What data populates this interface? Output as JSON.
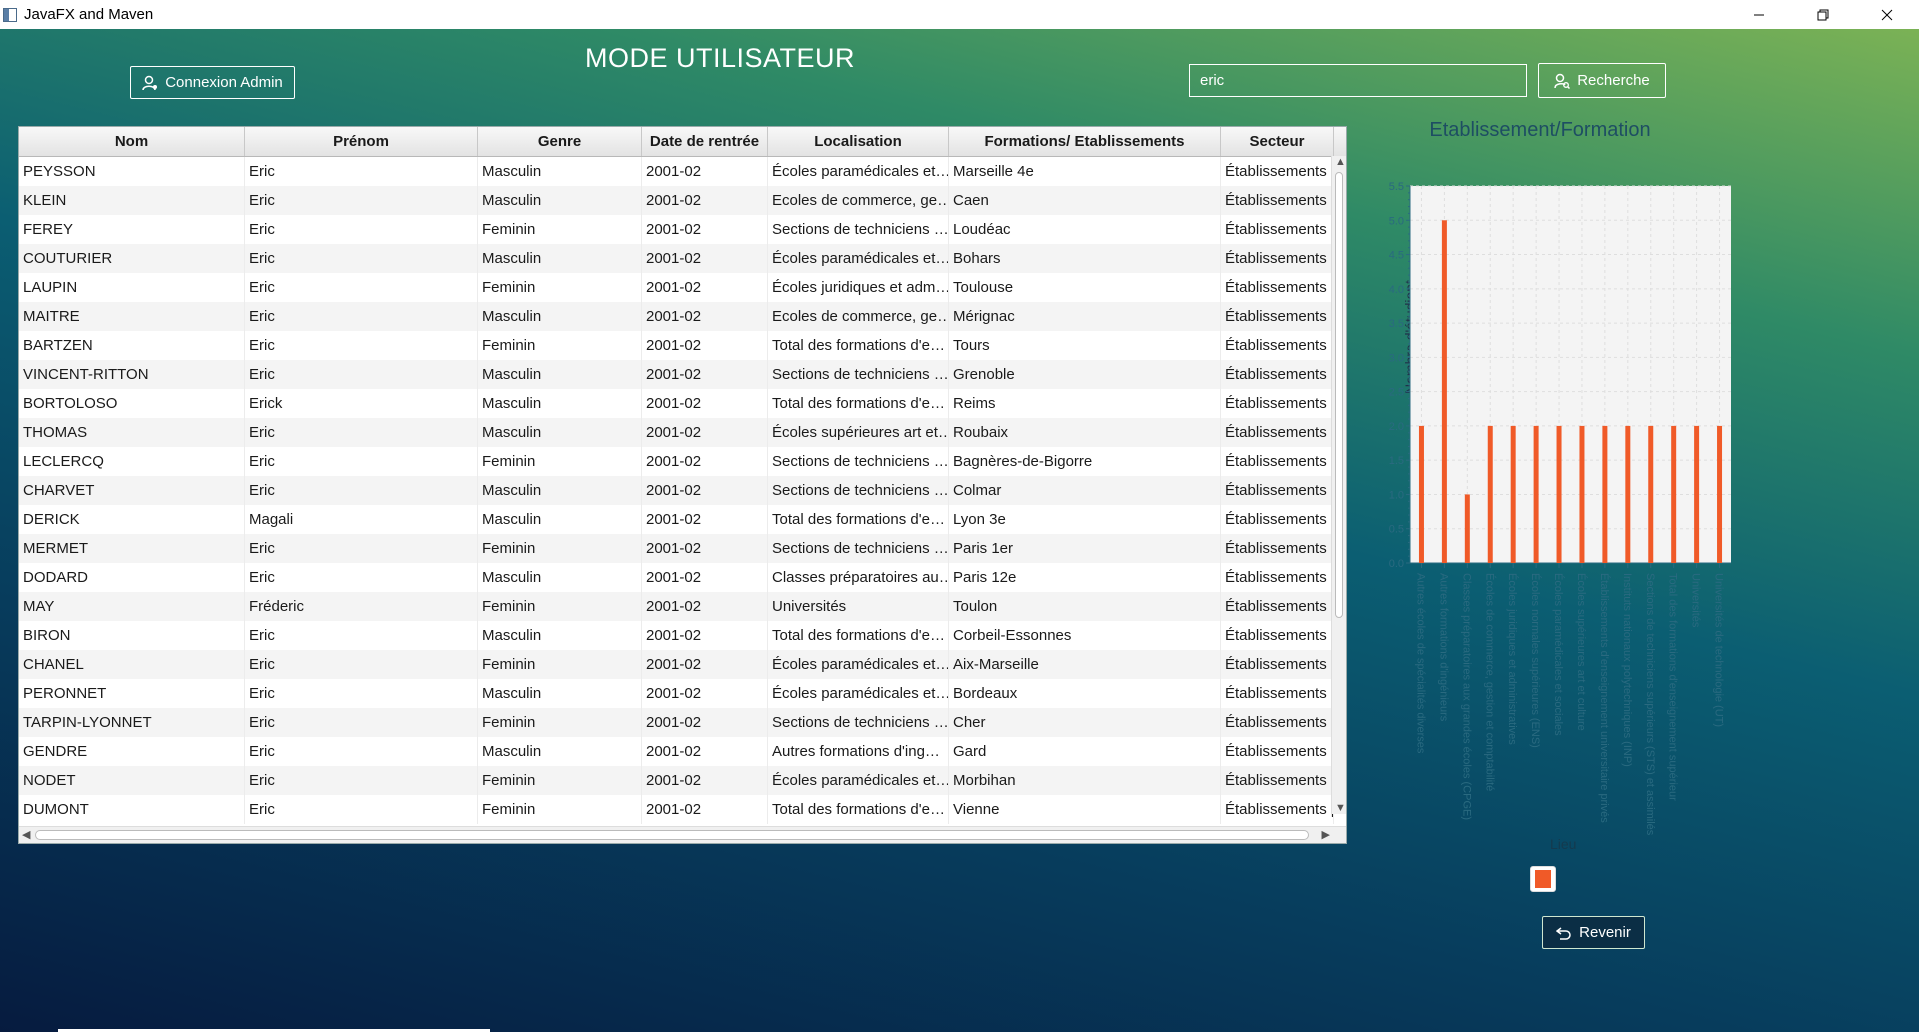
{
  "window": {
    "title": "JavaFX and Maven"
  },
  "header": {
    "admin_button": "Connexion Admin",
    "page_title": "MODE UTILISATEUR",
    "search_value": "eric",
    "search_button": "Recherche"
  },
  "table": {
    "columns": [
      "Nom",
      "Prénom",
      "Genre",
      "Date de rentrée",
      "Localisation",
      "Formations/ Etablissements",
      "Secteur"
    ],
    "rows": [
      [
        "PEYSSON",
        "Eric",
        "Masculin",
        "2001-02",
        "Écoles paramédicales et…",
        "Marseille  4e",
        "Établissements p"
      ],
      [
        "KLEIN",
        "Eric",
        "Masculin",
        "2001-02",
        "Ecoles de commerce, ge…",
        "Caen",
        "Établissements p"
      ],
      [
        "FEREY",
        "Eric",
        "Feminin",
        "2001-02",
        "Sections de techniciens …",
        "Loudéac",
        "Établissements p"
      ],
      [
        "COUTURIER",
        "Eric",
        "Masculin",
        "2001-02",
        "Écoles paramédicales et…",
        "Bohars",
        "Établissements p"
      ],
      [
        "LAUPIN",
        "Eric",
        "Feminin",
        "2001-02",
        "Écoles juridiques et adm…",
        "Toulouse",
        "Établissements p"
      ],
      [
        "MAITRE",
        "Eric",
        "Masculin",
        "2001-02",
        "Ecoles de commerce, ge…",
        "Mérignac",
        "Établissements p"
      ],
      [
        "BARTZEN",
        "Eric",
        "Feminin",
        "2001-02",
        "Total des formations d'e…",
        "Tours",
        "Établissements p"
      ],
      [
        "VINCENT-RITTON",
        "Eric",
        "Masculin",
        "2001-02",
        "Sections de techniciens …",
        "Grenoble",
        "Établissements p"
      ],
      [
        "BORTOLOSO",
        "Erick",
        "Masculin",
        "2001-02",
        "Total des formations d'e…",
        "Reims",
        "Établissements p"
      ],
      [
        "THOMAS",
        "Eric",
        "Masculin",
        "2001-02",
        "Écoles supérieures art et…",
        "Roubaix",
        "Établissements p"
      ],
      [
        "LECLERCQ",
        "Eric",
        "Feminin",
        "2001-02",
        "Sections de techniciens …",
        "Bagnères-de-Bigorre",
        "Établissements p"
      ],
      [
        "CHARVET",
        "Eric",
        "Masculin",
        "2001-02",
        "Sections de techniciens …",
        "Colmar",
        "Établissements p"
      ],
      [
        "DERICK",
        "Magali",
        "Masculin",
        "2001-02",
        "Total des formations d'e…",
        "Lyon 3e",
        "Établissements p"
      ],
      [
        "MERMET",
        "Eric",
        "Feminin",
        "2001-02",
        "Sections de techniciens …",
        "Paris  1er",
        "Établissements p"
      ],
      [
        "DODARD",
        "Eric",
        "Masculin",
        "2001-02",
        "Classes préparatoires au…",
        "Paris 12e",
        "Établissements p"
      ],
      [
        "MAY",
        "Fréderic",
        "Feminin",
        "2001-02",
        "Universités",
        "Toulon",
        "Établissements p"
      ],
      [
        "BIRON",
        "Eric",
        "Masculin",
        "2001-02",
        "Total des formations d'e…",
        "Corbeil-Essonnes",
        "Établissements p"
      ],
      [
        "CHANEL",
        "Eric",
        "Feminin",
        "2001-02",
        "Écoles paramédicales et…",
        "Aix-Marseille",
        "Établissements p"
      ],
      [
        "PERONNET",
        "Eric",
        "Masculin",
        "2001-02",
        "Écoles paramédicales et…",
        "Bordeaux",
        "Établissements p"
      ],
      [
        "TARPIN-LYONNET",
        "Eric",
        "Feminin",
        "2001-02",
        "Sections de techniciens …",
        "Cher",
        "Établissements p"
      ],
      [
        "GENDRE",
        "Eric",
        "Masculin",
        "2001-02",
        "Autres formations d'ing…",
        "Gard",
        "Établissements p"
      ],
      [
        "NODET",
        "Eric",
        "Feminin",
        "2001-02",
        "Écoles paramédicales et…",
        "Morbihan",
        "Établissements p"
      ],
      [
        "DUMONT",
        "Eric",
        "Feminin",
        "2001-02",
        "Total des formations d'e…",
        "Vienne",
        "Établissements p"
      ]
    ]
  },
  "chart_data": {
    "type": "bar",
    "title": "Etablissement/Formation",
    "ylabel": "Nombre d'étudiant",
    "xlabel": "",
    "legend_title": "Lieu",
    "ylim": [
      0,
      5.5
    ],
    "yticks": [
      "0.0",
      "0.5",
      "1.0",
      "1.5",
      "2.0",
      "2.5",
      "3.0",
      "3.5",
      "4.0",
      "4.5",
      "5.0",
      "5.5"
    ],
    "categories": [
      "Autres écoles de spécialités diverses",
      "Autres formations d'ingénieurs",
      "Classes préparatoires aux grandes écoles (CPGE)",
      "Écoles de commerce, gestion et comptabilité",
      "Écoles juridiques et administratives",
      "Écoles normales supérieures (ENS)",
      "Écoles paramédicales et sociales",
      "Écoles supérieures art et culture",
      "Établissements d'enseignement universitaire privés",
      "Instituts nationaux polytechniques (INP)",
      "Sections de techniciens supérieurs (STS) et assimilés",
      "Total des formations d'enseignement supérieur",
      "Universités",
      "Universités de technologie (UT)"
    ],
    "values": [
      2,
      5,
      1,
      2,
      2,
      2,
      2,
      2,
      2,
      2,
      2,
      2,
      2,
      2
    ],
    "color": "#f05a28",
    "grid": true,
    "legend_position": "bottom"
  },
  "footer": {
    "back_button": "Revenir"
  }
}
